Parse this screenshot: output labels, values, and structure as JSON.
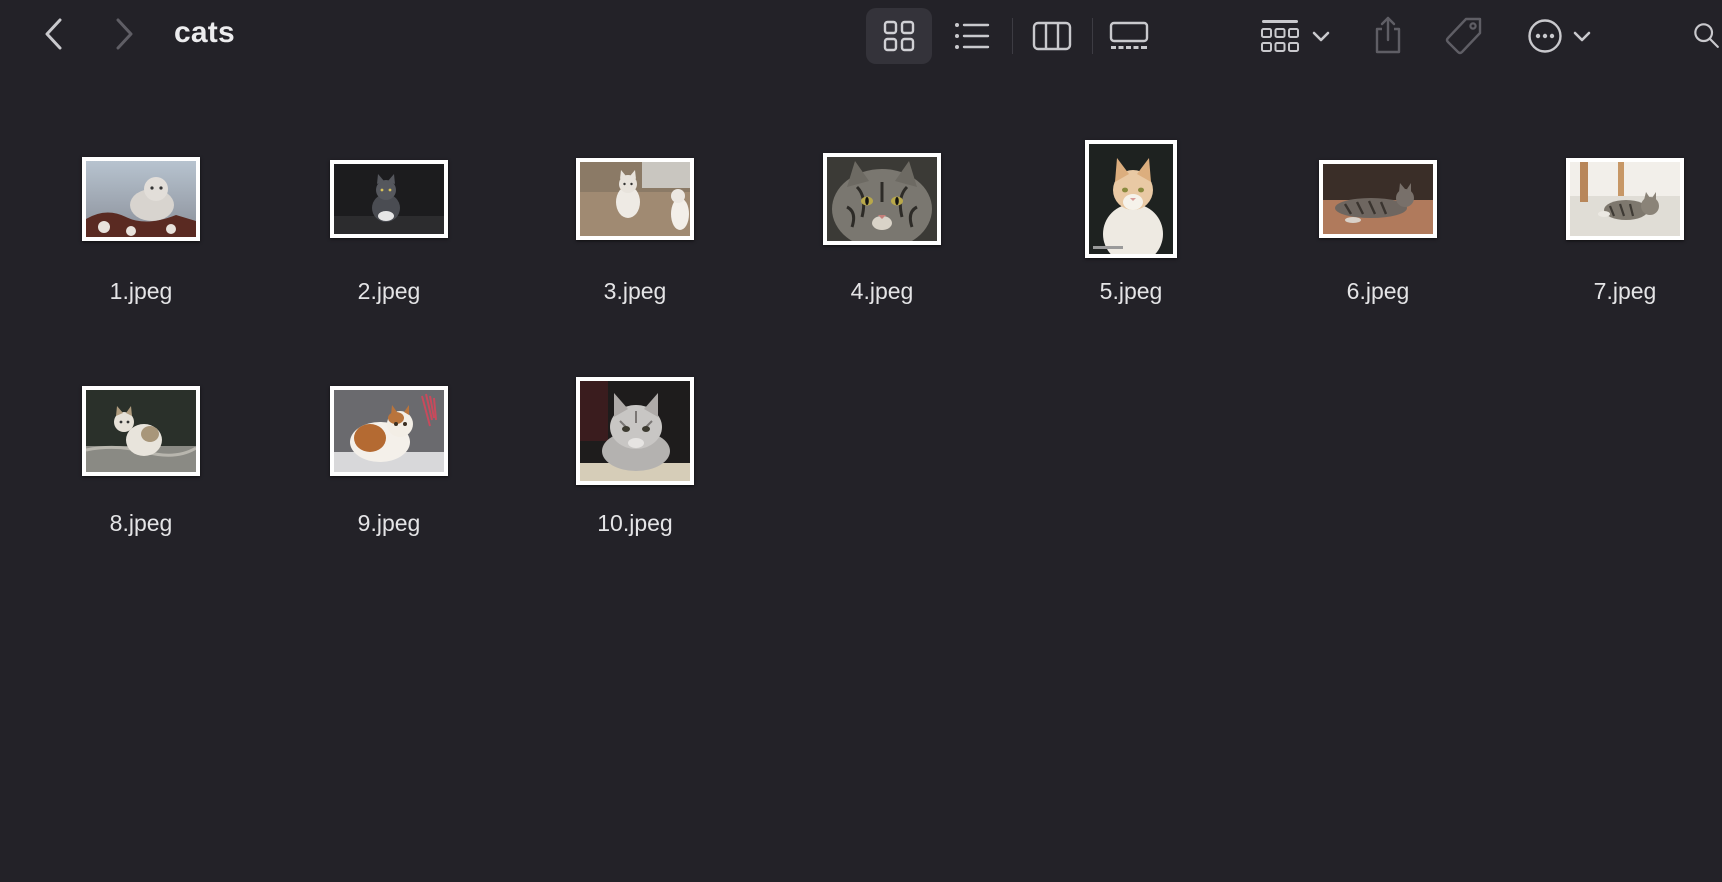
{
  "window": {
    "title": "cats"
  },
  "toolbar": {
    "icons": {
      "back": "chevron-left-icon",
      "forward": "chevron-right-icon",
      "icon_view": "grid-view-icon",
      "list_view": "list-view-icon",
      "column_view": "column-view-icon",
      "gallery_view": "gallery-view-icon",
      "group": "group-by-icon",
      "share": "share-icon",
      "tags": "tag-icon",
      "more": "ellipsis-circle-icon",
      "search": "search-icon"
    },
    "selected_view": "icons"
  },
  "files": [
    {
      "name": "1.jpeg"
    },
    {
      "name": "2.jpeg"
    },
    {
      "name": "3.jpeg"
    },
    {
      "name": "4.jpeg"
    },
    {
      "name": "5.jpeg"
    },
    {
      "name": "6.jpeg"
    },
    {
      "name": "7.jpeg"
    },
    {
      "name": "8.jpeg"
    },
    {
      "name": "9.jpeg"
    },
    {
      "name": "10.jpeg"
    }
  ],
  "colors": {
    "background": "#232228",
    "text": "#e4e4e6",
    "icon": "#c9c9cd",
    "icon_disabled": "#5f5e65",
    "selected_bg": "#34333a"
  }
}
